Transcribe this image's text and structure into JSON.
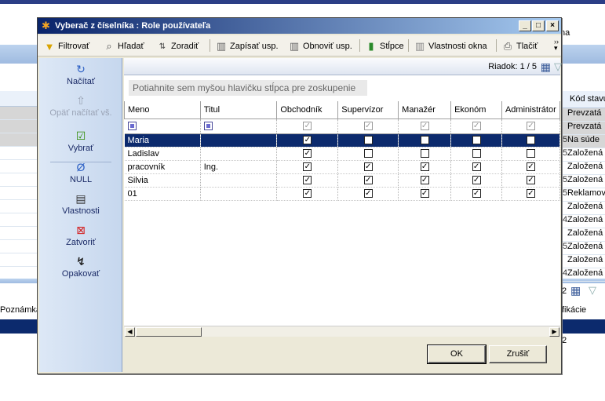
{
  "background": {
    "top_right_text": "na",
    "left_bottom_header": "Poznámka",
    "right_header": "Kód stavu",
    "right_rows": [
      {
        "prefix": "",
        "text": "Prevzatá"
      },
      {
        "prefix": "",
        "text": "Prevzatá"
      },
      {
        "prefix": "5",
        "text": "Na súde"
      },
      {
        "prefix": "5",
        "text": "Založená"
      },
      {
        "prefix": "",
        "text": "Založená"
      },
      {
        "prefix": "5",
        "text": "Založená"
      },
      {
        "prefix": "5",
        "text": "Reklamov"
      },
      {
        "prefix": "",
        "text": "Založená"
      },
      {
        "prefix": "4",
        "text": "Založená"
      },
      {
        "prefix": "",
        "text": "Založená"
      },
      {
        "prefix": "5",
        "text": "Založená"
      },
      {
        "prefix": "",
        "text": "Založená"
      },
      {
        "prefix": "4",
        "text": "Založená"
      }
    ],
    "right_lower_count": "2",
    "right_lower_header": "fikácie",
    "right_lower_row": "2"
  },
  "dialog": {
    "title": "Vyberač z číselníka : Role používateľa",
    "toolbar": {
      "filter": "Filtrovať",
      "find": "Hľadať",
      "sort": "Zoradiť",
      "save_layout": "Zapísať usp.",
      "restore_layout": "Obnoviť usp.",
      "columns": "Stĺpce",
      "window_props": "Vlastnosti okna",
      "print": "Tlačiť"
    },
    "side_actions": {
      "load": "Načítať",
      "reload_all": "Opäť načítať vš.",
      "select": "Vybrať",
      "null": "NULL",
      "properties": "Vlastnosti",
      "close": "Zatvoriť",
      "repeat": "Opakovať"
    },
    "row_counter": "Riadok: 1 / 5",
    "group_hint": "Potiahnite sem myšou hlavičku stĺpca pre zoskupenie",
    "columns": [
      "Meno",
      "Titul",
      "Obchodník",
      "Supervízor",
      "Manažér",
      "Ekonóm",
      "Administrátor"
    ],
    "rows": [
      {
        "meno": "Maria",
        "titul": "",
        "flags": [
          true,
          false,
          false,
          false,
          false
        ],
        "selected": true
      },
      {
        "meno": "Ladislav",
        "titul": "",
        "flags": [
          true,
          false,
          false,
          false,
          false
        ],
        "selected": false
      },
      {
        "meno": "pracovník",
        "titul": "Ing.",
        "flags": [
          true,
          true,
          true,
          true,
          true
        ],
        "selected": false
      },
      {
        "meno": "Silvia",
        "titul": "",
        "flags": [
          true,
          true,
          true,
          true,
          true
        ],
        "selected": false
      },
      {
        "meno": "01",
        "titul": "",
        "flags": [
          true,
          true,
          true,
          true,
          true
        ],
        "selected": false
      }
    ],
    "buttons": {
      "ok": "OK",
      "cancel": "Zrušiť"
    }
  }
}
